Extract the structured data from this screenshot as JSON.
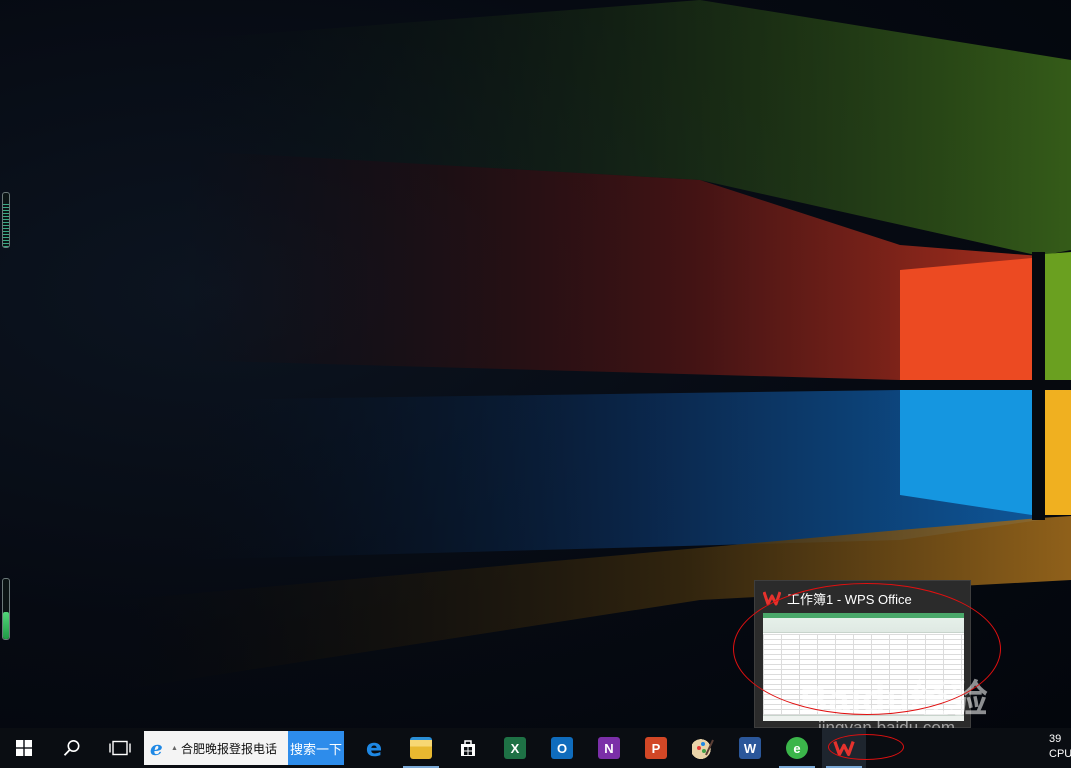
{
  "desktop": {
    "gauges": [
      {
        "name": "top",
        "level": 0.8
      },
      {
        "name": "bottom",
        "level": 0.45
      }
    ]
  },
  "taskbar": {
    "start_icon": "windows-logo-icon",
    "search_icon": "search-icon",
    "task_view_icon": "task-view-icon",
    "search_widget": {
      "browser_icon": "ie-icon",
      "query": "合肥晚报登报电话",
      "button_label": "搜索一下"
    },
    "apps": [
      {
        "id": "edge",
        "icon": "edge-icon",
        "running": false,
        "glyph": "e",
        "color": "#1e88e5"
      },
      {
        "id": "file-explorer",
        "icon": "folder-icon",
        "running": true,
        "glyph": "",
        "color": "#f4c542"
      },
      {
        "id": "store",
        "icon": "store-icon",
        "running": false,
        "glyph": "",
        "color": "#ffffff"
      },
      {
        "id": "excel",
        "icon": "excel-icon",
        "running": false,
        "glyph": "X",
        "color": "#1e7145"
      },
      {
        "id": "outlook",
        "icon": "outlook-icon",
        "running": false,
        "glyph": "O",
        "color": "#0f6cbd"
      },
      {
        "id": "onenote",
        "icon": "onenote-icon",
        "running": false,
        "glyph": "N",
        "color": "#7b2fa8"
      },
      {
        "id": "powerpoint",
        "icon": "powerpoint-icon",
        "running": false,
        "glyph": "P",
        "color": "#d24726"
      },
      {
        "id": "paint",
        "icon": "paint-palette-icon",
        "running": false,
        "glyph": "",
        "color": "#c8a878"
      },
      {
        "id": "word",
        "icon": "word-icon",
        "running": false,
        "glyph": "W",
        "color": "#2b579a"
      },
      {
        "id": "360-browser",
        "icon": "360-browser-icon",
        "running": true,
        "glyph": "e",
        "color": "#3bb54a"
      },
      {
        "id": "wps",
        "icon": "wps-office-icon",
        "running": true,
        "active": true,
        "glyph": "W",
        "color": "#e5322d"
      }
    ],
    "tray": {
      "line1": "39",
      "line2": "CPU"
    }
  },
  "thumbnail": {
    "title": "工作簿1 - WPS Office",
    "icon": "wps-office-icon"
  },
  "watermark": {
    "brand": "Baidu经验",
    "url": "jingyan.baidu.com"
  },
  "colors": {
    "taskbar_bg": "#0a0d12",
    "search_button": "#2d8ceb",
    "annotation": "#e01010",
    "wps_red": "#e5322d"
  }
}
